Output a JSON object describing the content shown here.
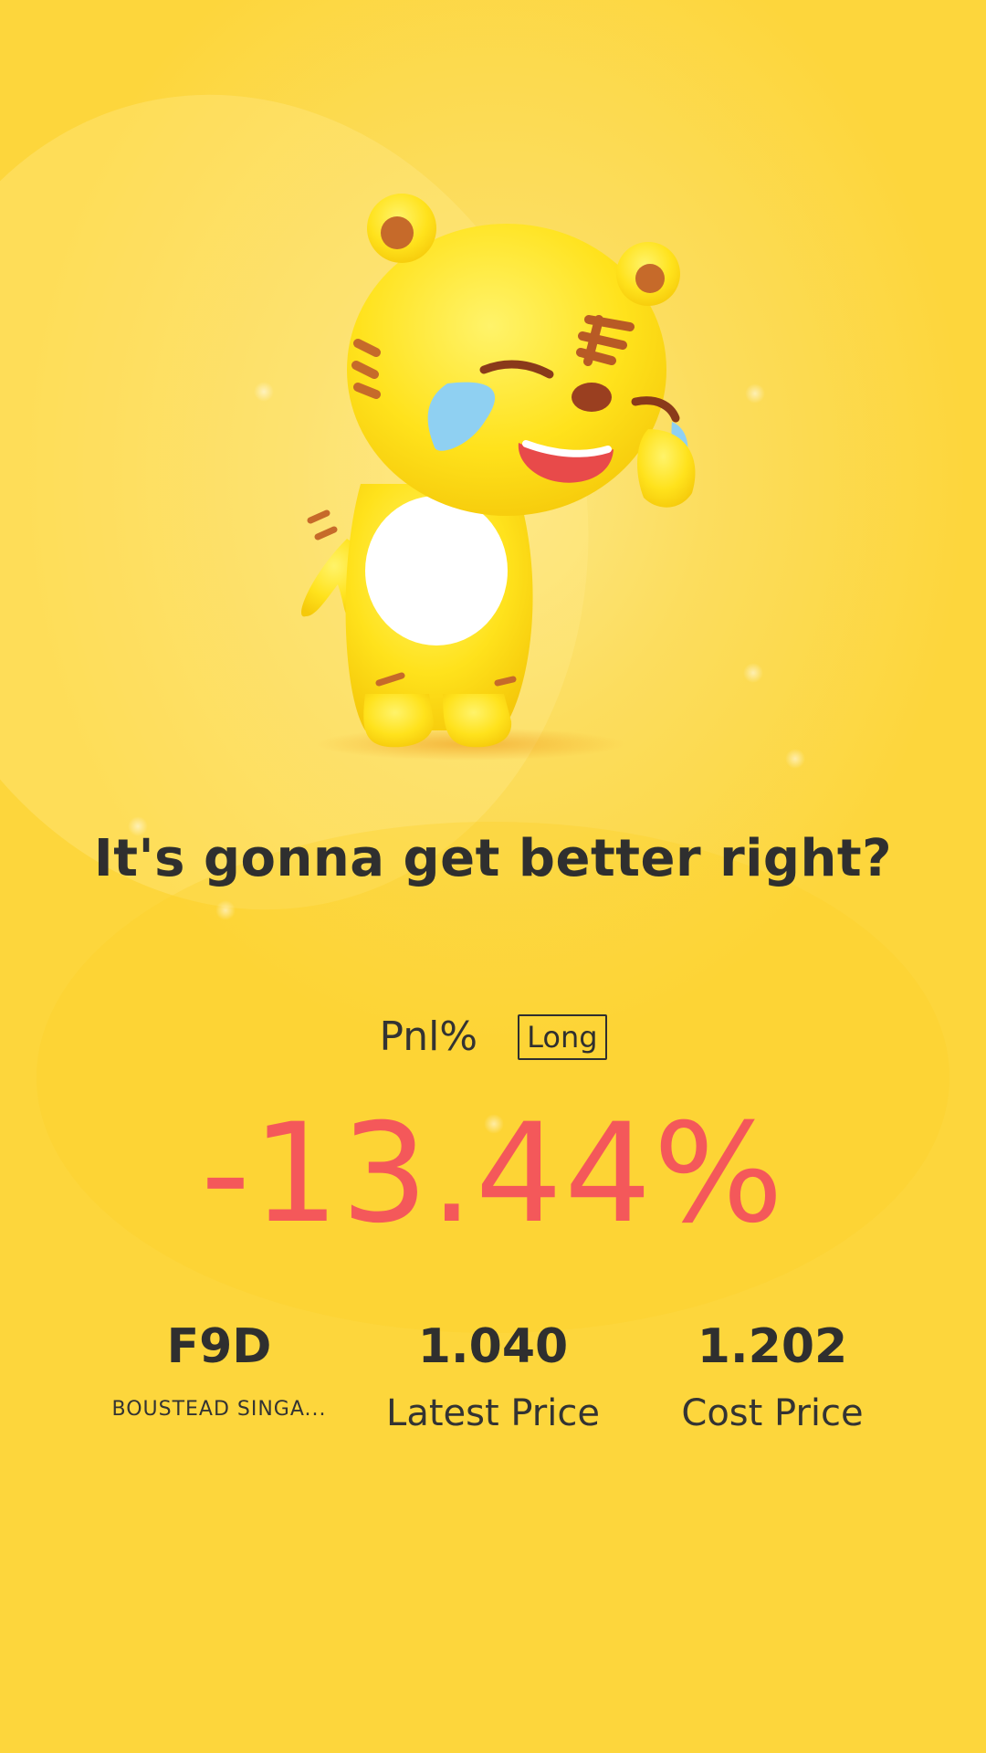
{
  "headline": "It's gonna get better right?",
  "pnl": {
    "label": "Pnl%",
    "position_tag": "Long",
    "value": "-13.44%"
  },
  "stats": [
    {
      "value": "F9D",
      "label": "BOUSTEAD SINGA..."
    },
    {
      "value": "1.040",
      "label": "Latest Price"
    },
    {
      "value": "1.202",
      "label": "Cost Price"
    }
  ],
  "colors": {
    "background": "#fdd63c",
    "loss": "#f4585a",
    "text": "#2f2f2f"
  },
  "icons": {
    "mascot": "crying-tiger-mascot"
  }
}
